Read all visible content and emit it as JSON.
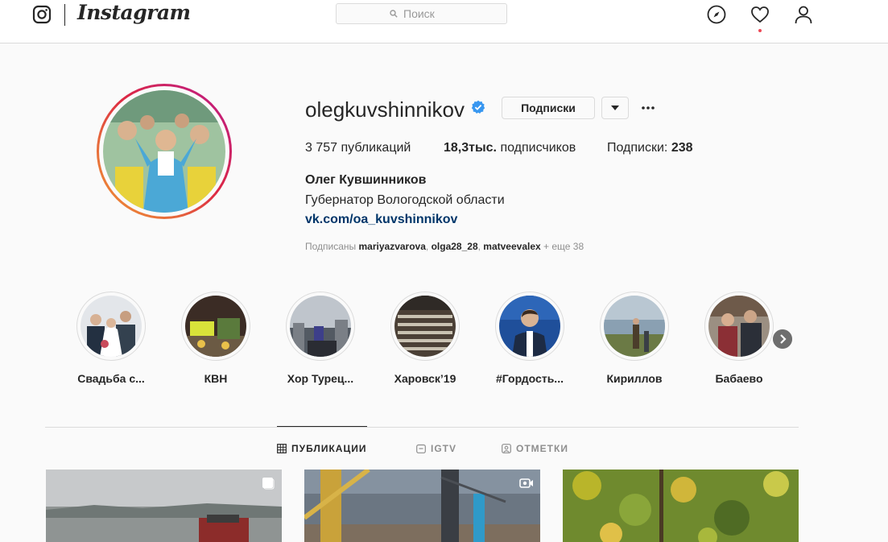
{
  "header": {
    "brand": "Instagram",
    "search_placeholder": "Поиск"
  },
  "profile": {
    "username": "olegkuvshinnikov",
    "following_button": "Подписки",
    "stats": {
      "posts_value": "3 757",
      "posts_label": "публикаций",
      "followers_value": "18,3тыс.",
      "followers_label": "подписчиков",
      "following_label": "Подписки:",
      "following_value": "238"
    },
    "full_name": "Олег Кувшинников",
    "bio": "Губернатор Вологодской области",
    "link": "vk.com/oa_kuvshinnikov",
    "followed_by": {
      "prefix": "Подписаны",
      "users": [
        "mariyazvarova",
        "olga28_28",
        "matveevalex"
      ],
      "more": "+ еще 38"
    }
  },
  "highlights": [
    {
      "label": "Свадьба с..."
    },
    {
      "label": "КВН"
    },
    {
      "label": "Хор Турец..."
    },
    {
      "label": "Харовск’19"
    },
    {
      "label": "#Гордость..."
    },
    {
      "label": "Кириллов"
    },
    {
      "label": "Бабаево"
    }
  ],
  "tabs": [
    {
      "label": "ПУБЛИКАЦИИ",
      "icon": "grid-icon",
      "active": true
    },
    {
      "label": "IGTV",
      "icon": "igtv-icon",
      "active": false
    },
    {
      "label": "ОТМЕТКИ",
      "icon": "tagged-icon",
      "active": false
    }
  ],
  "colors": {
    "link": "#003569",
    "verified": "#3897f0",
    "notification_dot": "#ed4956",
    "border": "#dbdbdb",
    "muted_text": "#8e8e8e"
  }
}
